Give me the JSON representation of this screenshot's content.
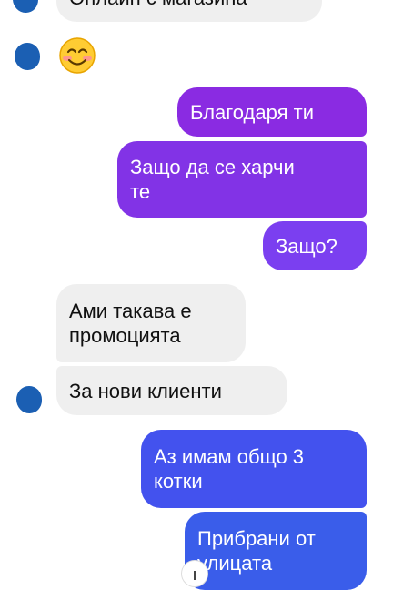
{
  "conversation": {
    "messages": [
      {
        "text": "Онлайн с магазина",
        "side": "in"
      },
      {
        "text": "😊",
        "side": "in",
        "kind": "emoji"
      },
      {
        "text": "Благодаря ти",
        "side": "out"
      },
      {
        "text": "Защо да се харчи\nте",
        "side": "out"
      },
      {
        "text": "Защо?",
        "side": "out"
      },
      {
        "text": "Ами такава е\nпромоцията",
        "side": "in"
      },
      {
        "text": "За нови клиенти",
        "side": "in"
      },
      {
        "text": "Аз имам общо 3\nкотки",
        "side": "out"
      },
      {
        "text": "Прибрани от\nулицата",
        "side": "out"
      }
    ]
  },
  "colors": {
    "incoming_bubble": "#efefef",
    "outgoing_purple": "#8a2be2",
    "outgoing_violet": "#7b3ff0",
    "outgoing_blue": "#3a5dea",
    "avatar": "#1b5fb3"
  }
}
